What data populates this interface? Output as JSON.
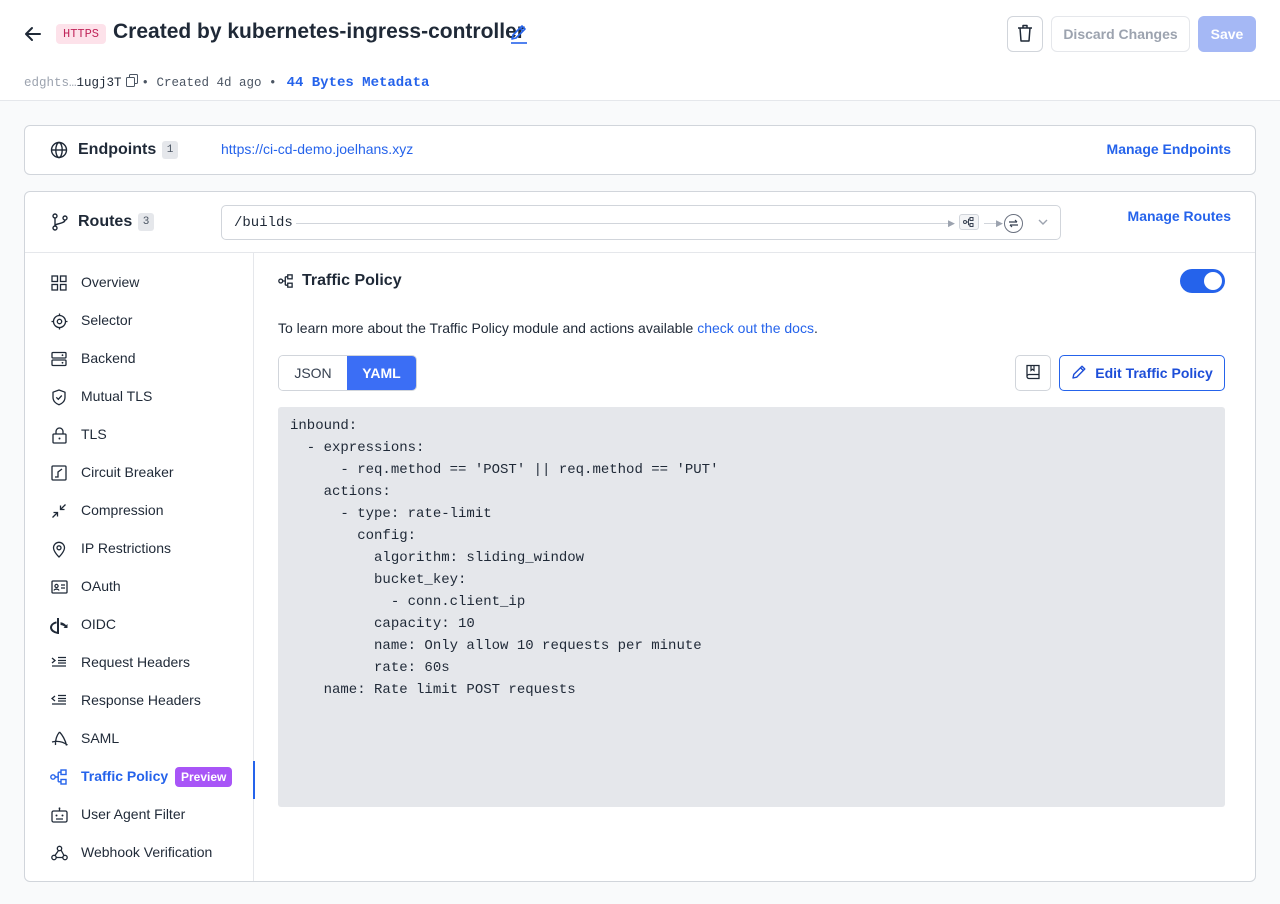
{
  "header": {
    "protocol_badge": "HTTPS",
    "title": "Created by kubernetes-ingress-controller",
    "id_prefix": "edghts…",
    "id_suffix": "1ugj3T",
    "created": "• Created 4d ago •",
    "metadata_link": "44 Bytes Metadata",
    "discard_label": "Discard Changes",
    "save_label": "Save"
  },
  "endpoints": {
    "label": "Endpoints",
    "count": "1",
    "url": "https://ci-cd-demo.joelhans.xyz",
    "manage_label": "Manage Endpoints"
  },
  "routes": {
    "label": "Routes",
    "count": "3",
    "selected_path": "/builds",
    "manage_label": "Manage Routes"
  },
  "sidebar": {
    "items": [
      {
        "label": "Overview",
        "icon": "grid-icon"
      },
      {
        "label": "Selector",
        "icon": "target-icon"
      },
      {
        "label": "Backend",
        "icon": "server-icon"
      },
      {
        "label": "Mutual TLS",
        "icon": "shield-check-icon"
      },
      {
        "label": "TLS",
        "icon": "lock-icon"
      },
      {
        "label": "Circuit Breaker",
        "icon": "circuit-icon"
      },
      {
        "label": "Compression",
        "icon": "compress-icon"
      },
      {
        "label": "IP Restrictions",
        "icon": "map-pin-icon"
      },
      {
        "label": "OAuth",
        "icon": "id-card-icon"
      },
      {
        "label": "OIDC",
        "icon": "openid-icon"
      },
      {
        "label": "Request Headers",
        "icon": "request-headers-icon"
      },
      {
        "label": "Response Headers",
        "icon": "response-headers-icon"
      },
      {
        "label": "SAML",
        "icon": "saml-icon"
      },
      {
        "label": "Traffic Policy",
        "icon": "traffic-policy-icon",
        "badge": "Preview"
      },
      {
        "label": "User Agent Filter",
        "icon": "robot-icon"
      },
      {
        "label": "Webhook Verification",
        "icon": "webhook-icon"
      }
    ]
  },
  "main": {
    "title": "Traffic Policy",
    "enabled": true,
    "description_prefix": "To learn more about the Traffic Policy module and actions available ",
    "description_link": "check out the docs",
    "description_suffix": ".",
    "tabs": [
      "JSON",
      "YAML"
    ],
    "active_tab": "YAML",
    "edit_label": "Edit Traffic Policy",
    "code": "inbound:\n  - expressions:\n      - req.method == 'POST' || req.method == 'PUT'\n    actions:\n      - type: rate-limit\n        config:\n          algorithm: sliding_window\n          bucket_key:\n            - conn.client_ip\n          capacity: 10\n          name: Only allow 10 requests per minute\n          rate: 60s\n    name: Rate limit POST requests"
  },
  "colors": {
    "accent": "#2563eb",
    "badge_https_bg": "#fde2ea",
    "preview_badge": "#a855f7",
    "save_disabled": "#a5b8f5"
  }
}
